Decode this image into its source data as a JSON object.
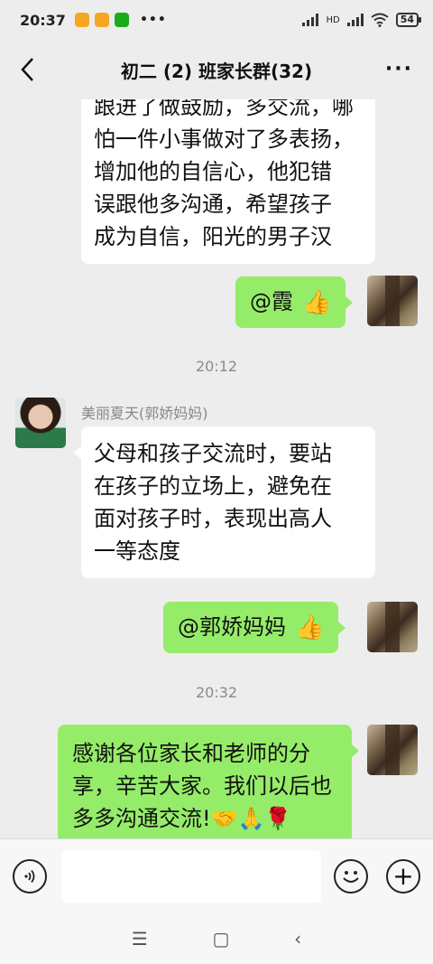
{
  "status_bar": {
    "time": "20:37",
    "dots": "•••",
    "network_label": "HD",
    "battery": "54"
  },
  "header": {
    "back_label": "‹",
    "title": "初二 (2) 班家长群(32)",
    "more_label": "···"
  },
  "messages": [
    {
      "id": "m1",
      "side": "left",
      "lines": [
        "跟进了做鼓励，多交流，哪",
        "怕一件小事做对了多表扬，",
        "增加他的自信心，他犯错",
        "误跟他多沟通，希望孩子",
        "成为自信，阳光的男子汉"
      ]
    },
    {
      "id": "m2",
      "side": "right",
      "text": "@霞",
      "emoji": "👍"
    },
    {
      "id": "t1",
      "type": "time",
      "text": "20:12"
    },
    {
      "id": "m3",
      "side": "left",
      "sender": "美丽夏天(郭娇妈妈)",
      "lines": [
        "父母和孩子交流时，要站",
        "在孩子的立场上，避免在",
        "面对孩子时，表现出高人",
        "一等态度"
      ]
    },
    {
      "id": "m4",
      "side": "right",
      "text": "@郭娇妈妈",
      "emoji": "👍"
    },
    {
      "id": "t2",
      "type": "time",
      "text": "20:32"
    },
    {
      "id": "m5",
      "side": "right",
      "lines": [
        "感谢各位家长和老师的分",
        "享，辛苦大家。我们以后也",
        "多多沟通交流!🤝🙏🌹"
      ]
    }
  ],
  "input_bar": {
    "voice_icon": "voice-icon",
    "input_value": "",
    "emoji_icon": "emoji-icon",
    "plus_label": "+"
  },
  "system_nav": {
    "menu": "☰",
    "home": "▢",
    "back": "‹"
  }
}
